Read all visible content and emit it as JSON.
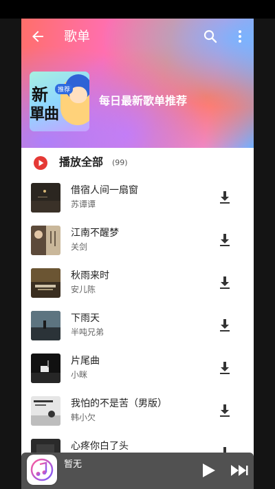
{
  "header": {
    "title": "歌单"
  },
  "hero": {
    "headline": "每日最新歌单推荐",
    "cover": {
      "text_line1": "新",
      "text_line2": "單曲",
      "tag": "推荐"
    }
  },
  "playall": {
    "label": "播放全部",
    "count": "(99)"
  },
  "songs": [
    {
      "title": "借宿人间一扇窗",
      "artist": "苏谭谭"
    },
    {
      "title": "江南不醒梦",
      "artist": "关剑"
    },
    {
      "title": "秋雨来时",
      "artist": "安儿陈"
    },
    {
      "title": "下雨天",
      "artist": "半吨兄弟"
    },
    {
      "title": "片尾曲",
      "artist": "小眯"
    },
    {
      "title": "我怕的不是苦（男版）",
      "artist": "韩小欠"
    },
    {
      "title": "心疼你白了头",
      "artist": ""
    }
  ],
  "player": {
    "now_playing": "暂无"
  },
  "colors": {
    "accent_red": "#e53935",
    "player_bg": "#515151"
  }
}
